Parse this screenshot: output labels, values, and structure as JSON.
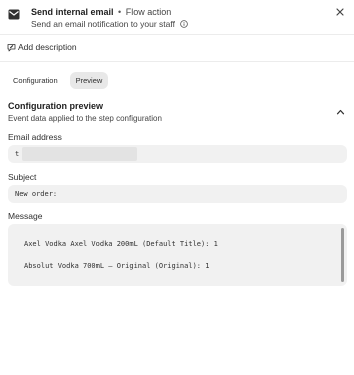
{
  "header": {
    "title": "Send internal email",
    "separator": "•",
    "kind": "Flow action",
    "subtitle": "Send an email notification to your staff",
    "icons": {
      "leading": "mail-icon",
      "info": "info-icon",
      "close": "close-icon"
    }
  },
  "description": {
    "label": "Add description",
    "icon": "comment-edit-icon"
  },
  "tabs": [
    {
      "label": "Configuration",
      "active": false
    },
    {
      "label": "Preview",
      "active": true
    }
  ],
  "preview": {
    "title": "Configuration preview",
    "subtitle": "Event data applied to the step configuration",
    "collapse_icon": "chevron-up-icon",
    "fields": {
      "email": {
        "label": "Email address",
        "value": "t"
      },
      "subject": {
        "label": "Subject",
        "value": "New order:"
      },
      "message": {
        "label": "Message",
        "lines": [
          "Axel Vodka Axel Vodka 200mL (Default Title): 1",
          "Absolut Vodka 700mL – Original (Original): 1"
        ]
      }
    }
  },
  "colors": {
    "text": "#303030",
    "tab_active_bg": "#e8e8e8",
    "field_bg": "#f1f1f1"
  }
}
